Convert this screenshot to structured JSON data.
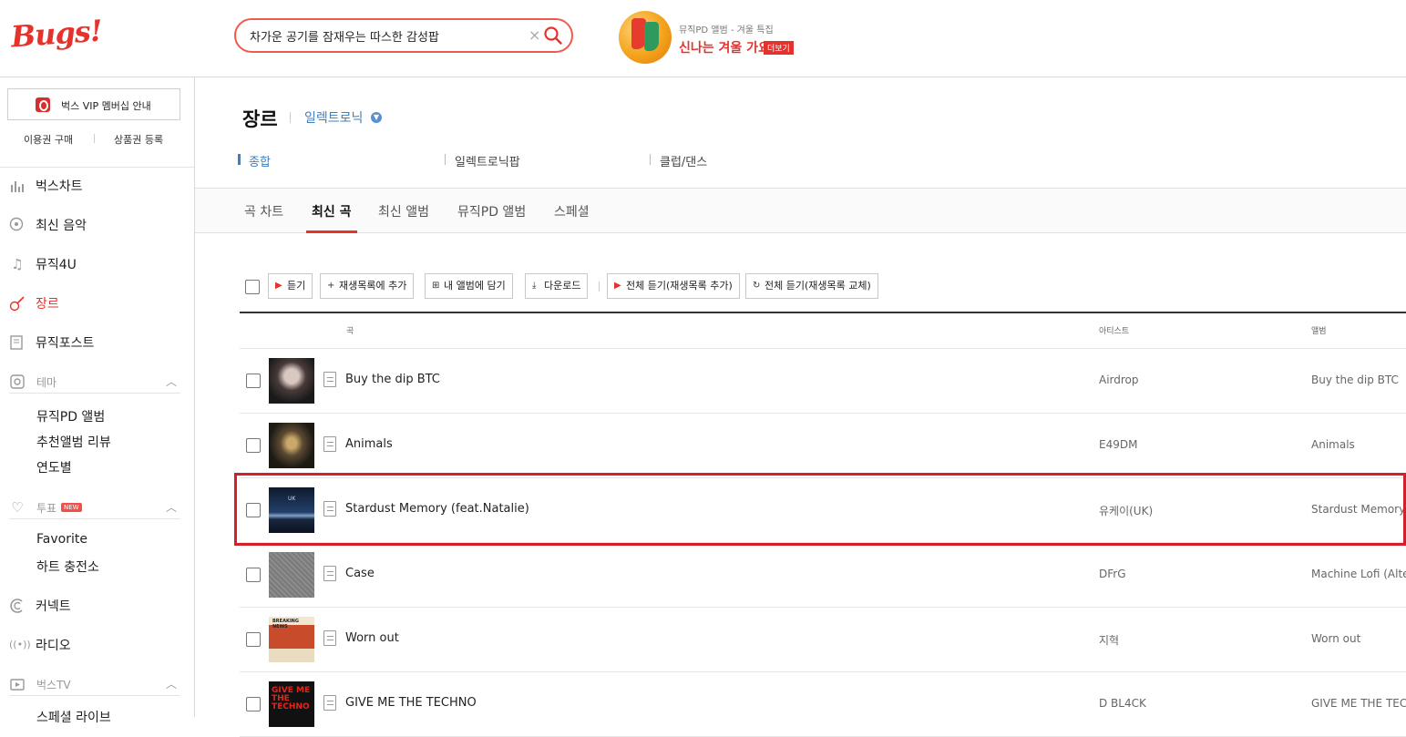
{
  "header": {
    "logo": "Bugs!",
    "search_value": "차가운 공기를 잠재우는 따스한 감성팝",
    "promo_subtitle": "뮤직PD 앨범 - 겨울 특집",
    "promo_title": "신나는 겨울 가요",
    "promo_more": "더보기"
  },
  "sidebar": {
    "vip_label": "벅스 VIP 멤버십 안내",
    "link_buy": "이용권 구매",
    "link_coupon": "상품권 등록",
    "nav": {
      "chart": "벅스차트",
      "latest": "최신 음악",
      "music4u": "뮤직4U",
      "genre": "장르",
      "musicpost": "뮤직포스트",
      "theme": "테마",
      "theme_items": [
        "뮤직PD 앨범",
        "추천앨범 리뷰",
        "연도별"
      ],
      "vote": "투표",
      "vote_badge": "NEW",
      "vote_items": [
        "Favorite",
        "하트 충전소"
      ],
      "connect": "커넥트",
      "radio": "라디오",
      "bugstv": "벅스TV",
      "bugstv_items": [
        "스페셜 라이브"
      ]
    }
  },
  "main": {
    "genre_title": "장르",
    "genre_selected": "일렉트로닉",
    "subgenres": [
      "종합",
      "일렉트로닉팝",
      "클럽/댄스"
    ],
    "tabs": [
      "곡 차트",
      "최신 곡",
      "최신 앨범",
      "뮤직PD 앨범",
      "스페셜"
    ],
    "active_tab": "최신 곡",
    "toolbar": {
      "listen": "듣기",
      "add_playlist": "재생목록에 추가",
      "add_album": "내 앨범에 담기",
      "download": "다운로드",
      "play_all_add": "전체 듣기(재생목록 추가)",
      "play_all_replace": "전체 듣기(재생목록 교체)"
    },
    "columns": {
      "song": "곡",
      "artist": "아티스트",
      "album": "앨범"
    },
    "songs": [
      {
        "title": "Buy the dip BTC",
        "artist": "Airdrop",
        "album": "Buy the dip BTC"
      },
      {
        "title": "Animals",
        "artist": "E49DM",
        "album": "Animals"
      },
      {
        "title": "Stardust Memory (feat.Natalie)",
        "artist": "유케이(UK)",
        "album": "Stardust Memory"
      },
      {
        "title": "Case",
        "artist": "DFrG",
        "album": "Machine Lofi (Alter"
      },
      {
        "title": "Worn out",
        "artist": "지혁",
        "album": "Worn out"
      },
      {
        "title": "GIVE ME THE TECHNO",
        "artist": "D BL4CK",
        "album": "GIVE ME THE TECH"
      }
    ],
    "thumb_text": {
      "uk": "UK",
      "news": "BREAKING NEWS",
      "techno": "GIVE ME THE TECHNO"
    }
  },
  "colors": {
    "brand": "#e5322d",
    "link": "#3c7fc0",
    "highlight": "#d4202a"
  }
}
